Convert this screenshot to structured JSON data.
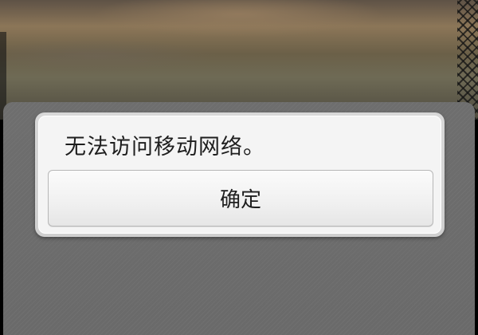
{
  "dialog": {
    "message": "无法访问移动网络。",
    "confirm_label": "确定"
  },
  "colors": {
    "dim_overlay": "#6e6e6e",
    "dialog_bg": "#f4f4f4",
    "dialog_frame": "#d8d8d8",
    "text": "#1e1e1e"
  }
}
